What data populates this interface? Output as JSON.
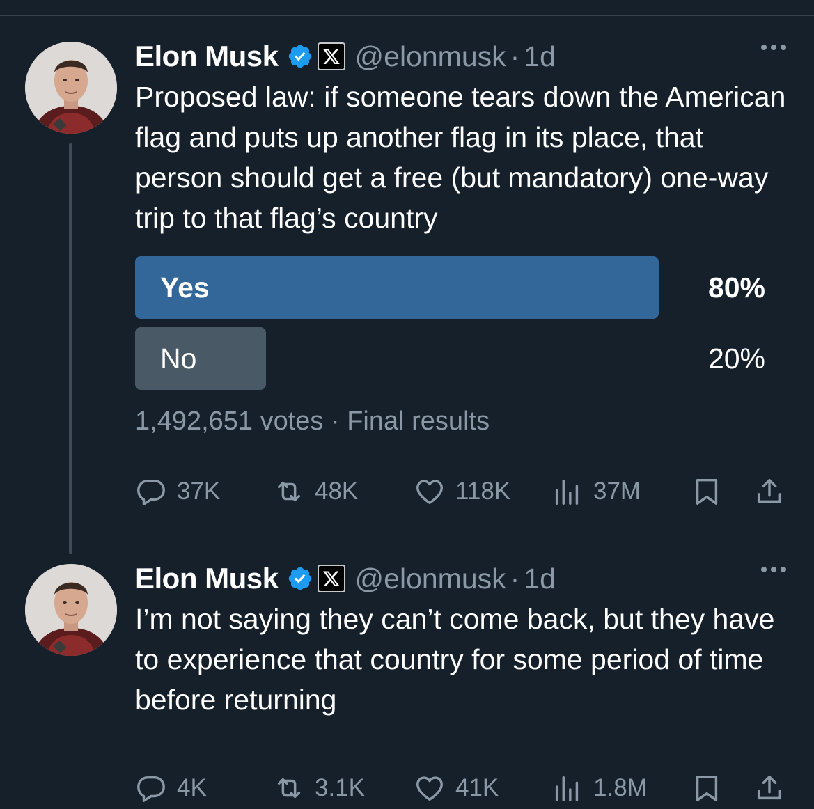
{
  "tweets": [
    {
      "author": {
        "name": "Elon Musk",
        "handle": "@elonmusk",
        "time": "1d"
      },
      "text": "Proposed law: if someone tears down the American flag and puts up another flag in its place, that person should get a free (but mandatory) one-way trip to that flag’s country",
      "poll": {
        "options": [
          {
            "label": "Yes",
            "percent": "80%",
            "fraction": 0.8,
            "color": "#336699",
            "leading": true
          },
          {
            "label": "No",
            "percent": "20%",
            "fraction": 0.2,
            "color": "#4a5966",
            "leading": false
          }
        ],
        "votes": "1,492,651 votes",
        "status": "Final results"
      },
      "stats": {
        "replies": "37K",
        "reposts": "48K",
        "likes": "118K",
        "views": "37M"
      }
    },
    {
      "author": {
        "name": "Elon Musk",
        "handle": "@elonmusk",
        "time": "1d"
      },
      "text": "I’m not saying they can’t come back, but they have to experience that country for some period of time before returning",
      "stats": {
        "replies": "4K",
        "reposts": "3.1K",
        "likes": "41K",
        "views": "1.8M"
      }
    }
  ],
  "colors": {
    "background": "#15202b",
    "muted": "#8b98a5",
    "verified": "#1d9bf0",
    "thread_line": "#3e4c59"
  },
  "icons": [
    "verified-badge-icon",
    "x-logo-icon",
    "more-icon",
    "reply-icon",
    "repost-icon",
    "like-icon",
    "views-icon",
    "bookmark-icon",
    "share-icon"
  ]
}
